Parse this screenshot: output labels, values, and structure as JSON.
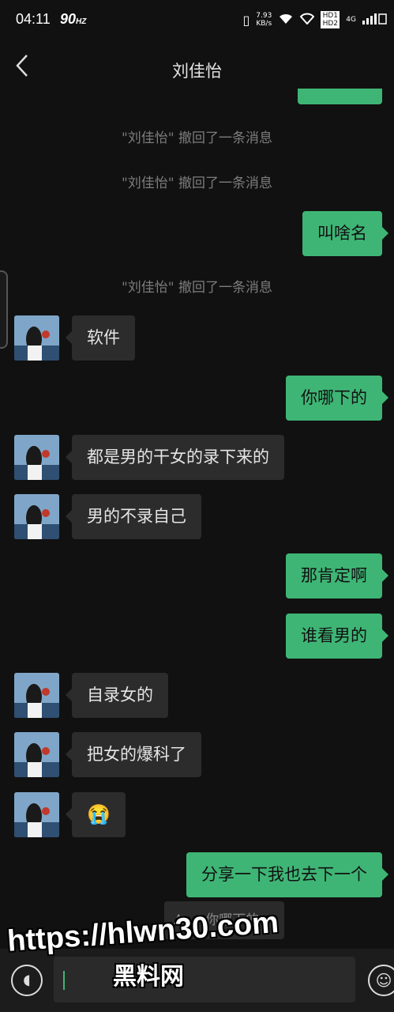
{
  "status_bar": {
    "time": "04:11",
    "refresh": "90",
    "refresh_unit": "HZ",
    "speed_value": "7.93",
    "speed_unit": "KB/s",
    "network": "4G",
    "hd": "HD1 HD2"
  },
  "header": {
    "back_icon": "chevron-left-icon",
    "title": "刘佳怡"
  },
  "messages": [
    {
      "type": "system",
      "text": "\"刘佳怡\" 撤回了一条消息"
    },
    {
      "type": "system",
      "text": "\"刘佳怡\" 撤回了一条消息"
    },
    {
      "type": "outgoing",
      "text": "叫啥名"
    },
    {
      "type": "system",
      "text": "\"刘佳怡\" 撤回了一条消息"
    },
    {
      "type": "incoming",
      "text": "软件"
    },
    {
      "type": "outgoing",
      "text": "你哪下的"
    },
    {
      "type": "incoming",
      "text": "都是男的干女的录下来的"
    },
    {
      "type": "incoming",
      "text": "男的不录自己"
    },
    {
      "type": "outgoing",
      "text": "那肯定啊"
    },
    {
      "type": "outgoing",
      "text": "谁看男的"
    },
    {
      "type": "incoming",
      "text": "自录女的"
    },
    {
      "type": "incoming",
      "text": "把女的爆科了"
    },
    {
      "type": "incoming",
      "text": "😭"
    },
    {
      "type": "outgoing",
      "text": "分享一下我也去下一个"
    }
  ],
  "quote": {
    "text": "An：你哪下的"
  },
  "input_bar": {
    "voice_icon": "voice-icon",
    "emoji_icon": "emoji-icon"
  },
  "watermark": {
    "url": "https://hlwn30.com",
    "name": "黑料网"
  },
  "colors": {
    "background": "#111111",
    "outgoing_bubble": "#3eb575",
    "incoming_bubble": "#2c2c2c"
  }
}
